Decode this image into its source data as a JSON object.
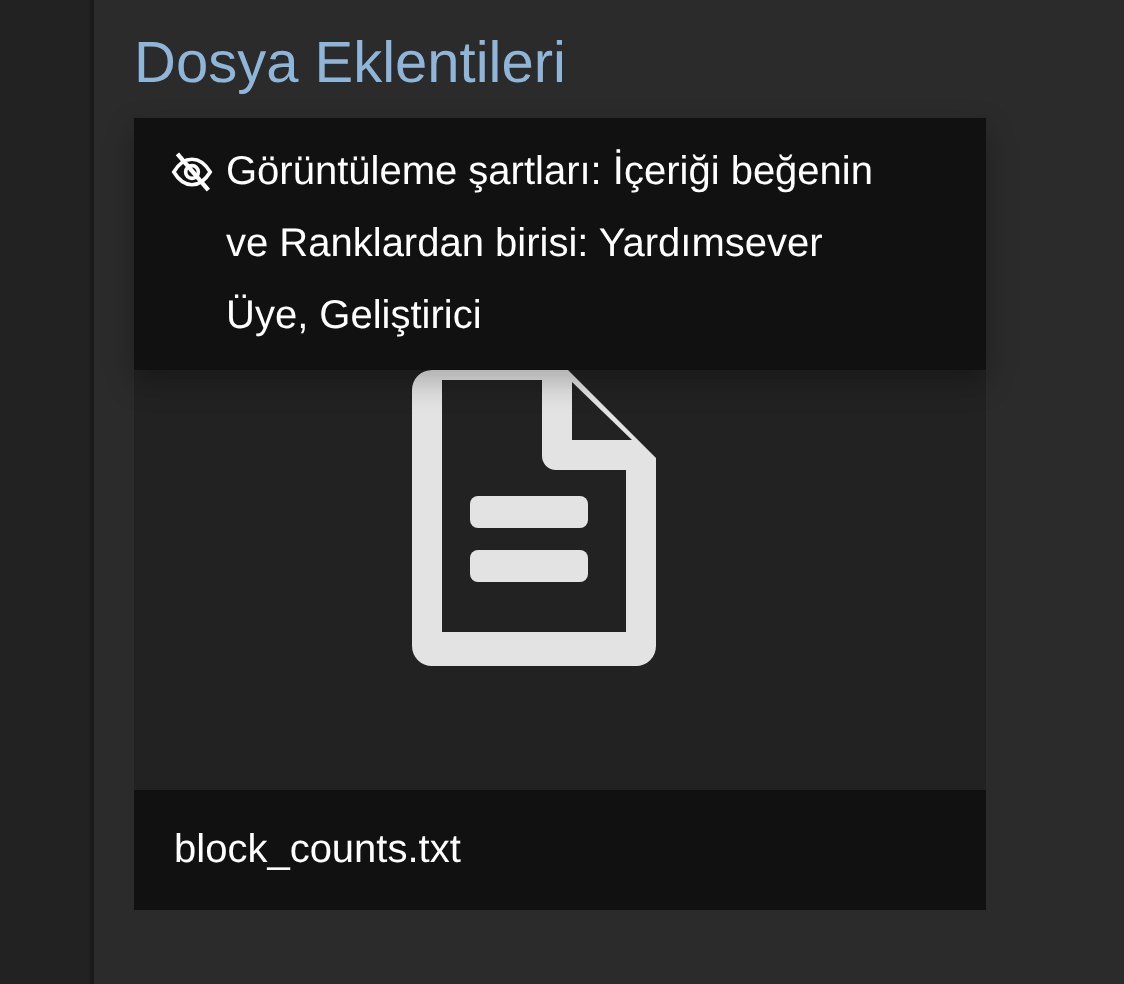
{
  "section_title": "Dosya Eklentileri",
  "attachment": {
    "restriction": "Görüntüleme şartları: İçeriği beğenin ve Ranklardan birisi: Yardımsever Üye, Geliştirici",
    "filename": "block_counts.txt"
  }
}
